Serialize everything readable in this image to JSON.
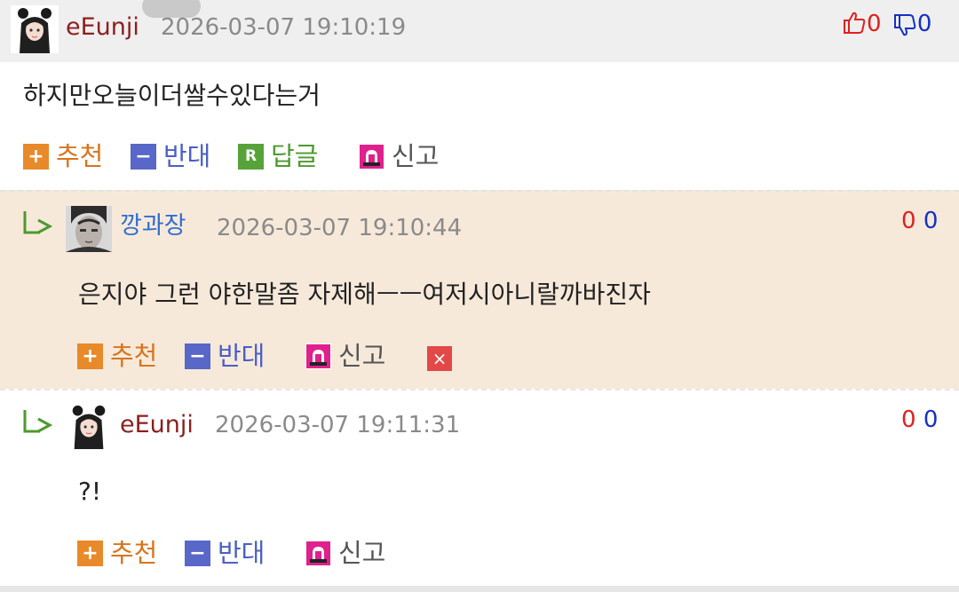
{
  "comments": [
    {
      "nickname": "eEunji",
      "timestamp": "2026-03-07 19:10:19",
      "content": "하지만오늘이더쌀수있다는거",
      "likes": "0",
      "dislikes": "0"
    },
    {
      "nickname": "깡과장",
      "timestamp": "2026-03-07 19:10:44",
      "content": "은지야 그런 야한말좀 자제해ㅡㅡ여저시아니랄까바진자",
      "likes": "0",
      "dislikes": "0"
    },
    {
      "nickname": "eEunji",
      "timestamp": "2026-03-07 19:11:31",
      "content": "?!",
      "likes": "0",
      "dislikes": "0"
    }
  ],
  "actions": {
    "recommend": "추천",
    "oppose": "반대",
    "reply": "답글",
    "report": "신고"
  },
  "icons": {
    "recommend": "plus-icon",
    "oppose": "minus-icon",
    "reply": "reply-r-icon",
    "report": "siren-icon",
    "delete": "close-icon",
    "reply_arrow": "reply-arrow-icon",
    "thumb_up": "thumb-up-icon",
    "thumb_down": "thumb-down-icon"
  },
  "glyphs": {
    "plus": "+",
    "minus": "−",
    "reply": "R",
    "delete": "×"
  },
  "colors": {
    "like": "#e02020",
    "dislike": "#1530c8",
    "recommend": "#e8892a",
    "oppose": "#5867c8",
    "reply": "#57a33a",
    "reply_highlight_bg": "#f7e9da"
  }
}
